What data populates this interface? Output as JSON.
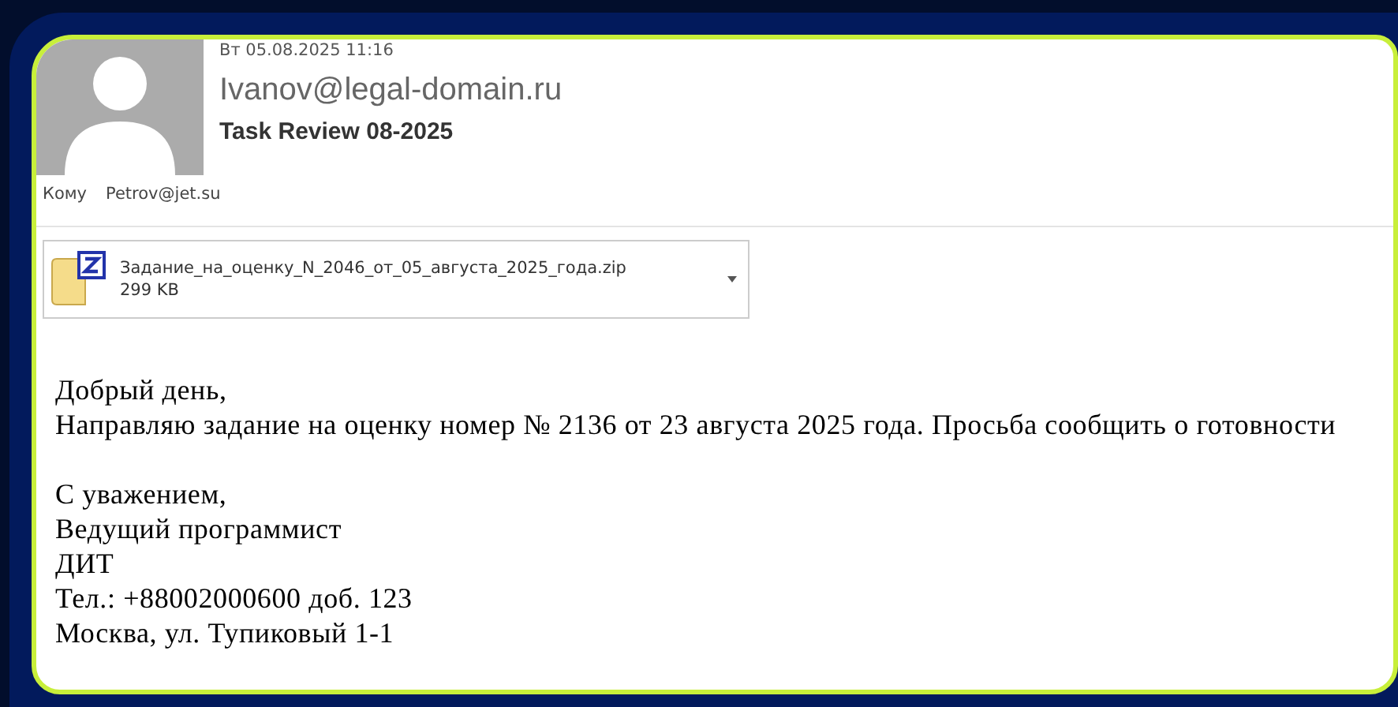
{
  "message": {
    "date": "Вт 05.08.2025 11:16",
    "sender": "Ivanov@legal-domain.ru",
    "subject": "Task Review 08-2025",
    "to_label": "Кому",
    "to": "Petrov@jet.su"
  },
  "attachment": {
    "name": "Задание_на_оценку_N_2046_от_05_августа_2025_года.zip",
    "size": "299 KB"
  },
  "body": {
    "message_lines": [
      "Добрый день,",
      "Направляю задание на оценку номер № 2136 от 23 августа 2025 года. Просьба сообщить о готовности"
    ],
    "signature_lines": [
      "С уважением,",
      "Ведущий программист",
      "ДИТ",
      "Тел.: +88002000600 доб. 123",
      "Москва, ул. Тупиковый 1-1"
    ]
  }
}
